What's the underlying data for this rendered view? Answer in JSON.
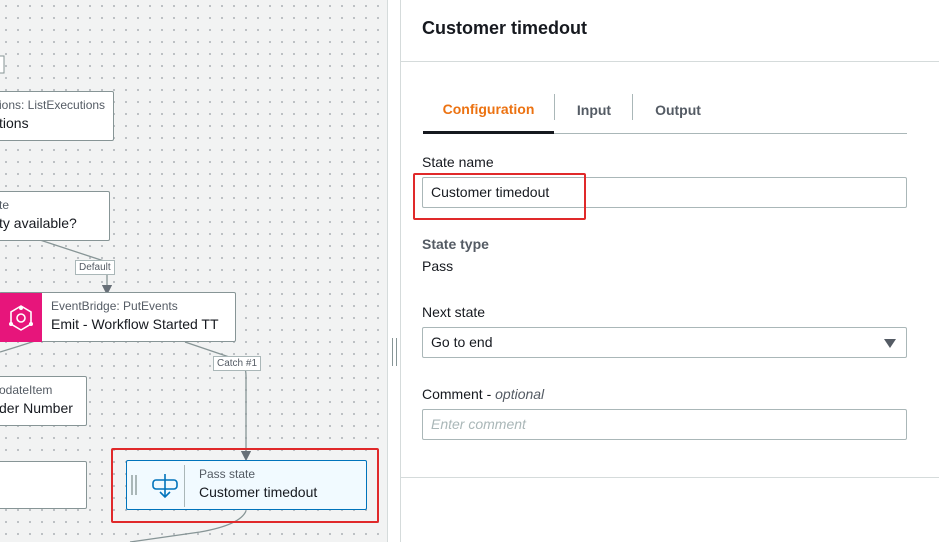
{
  "canvas": {
    "nodes": [
      {
        "sub": "ions: ListExecutions",
        "main": "tions"
      },
      {
        "sub": "te",
        "main": "ty available?"
      },
      {
        "sub": "EventBridge: PutEvents",
        "main": "Emit - Workflow Started TT"
      },
      {
        "sub": "odateItem",
        "main": "der Number"
      },
      {
        "sub": "Pass state",
        "main": "Customer timedout"
      }
    ],
    "edge_labels": [
      "Default",
      "Catch #1"
    ],
    "icons": {
      "eventbridge": "eventbridge-icon",
      "pass": "pass-state-icon"
    }
  },
  "panel": {
    "title": "Customer timedout",
    "tabs": [
      "Configuration",
      "Input",
      "Output"
    ],
    "active_tab": "Configuration",
    "state_name_label": "State name",
    "state_name_value": "Customer timedout",
    "state_type_label": "State type",
    "state_type_value": "Pass",
    "next_state_label": "Next state",
    "next_state_value": "Go to end",
    "comment_label": "Comment - ",
    "comment_optional": "optional",
    "comment_placeholder": "Enter comment"
  },
  "colors": {
    "accent": "#ec7211",
    "highlight": "#e0292a",
    "eventbridge": "#e7157b",
    "selected_border": "#0073bb"
  }
}
